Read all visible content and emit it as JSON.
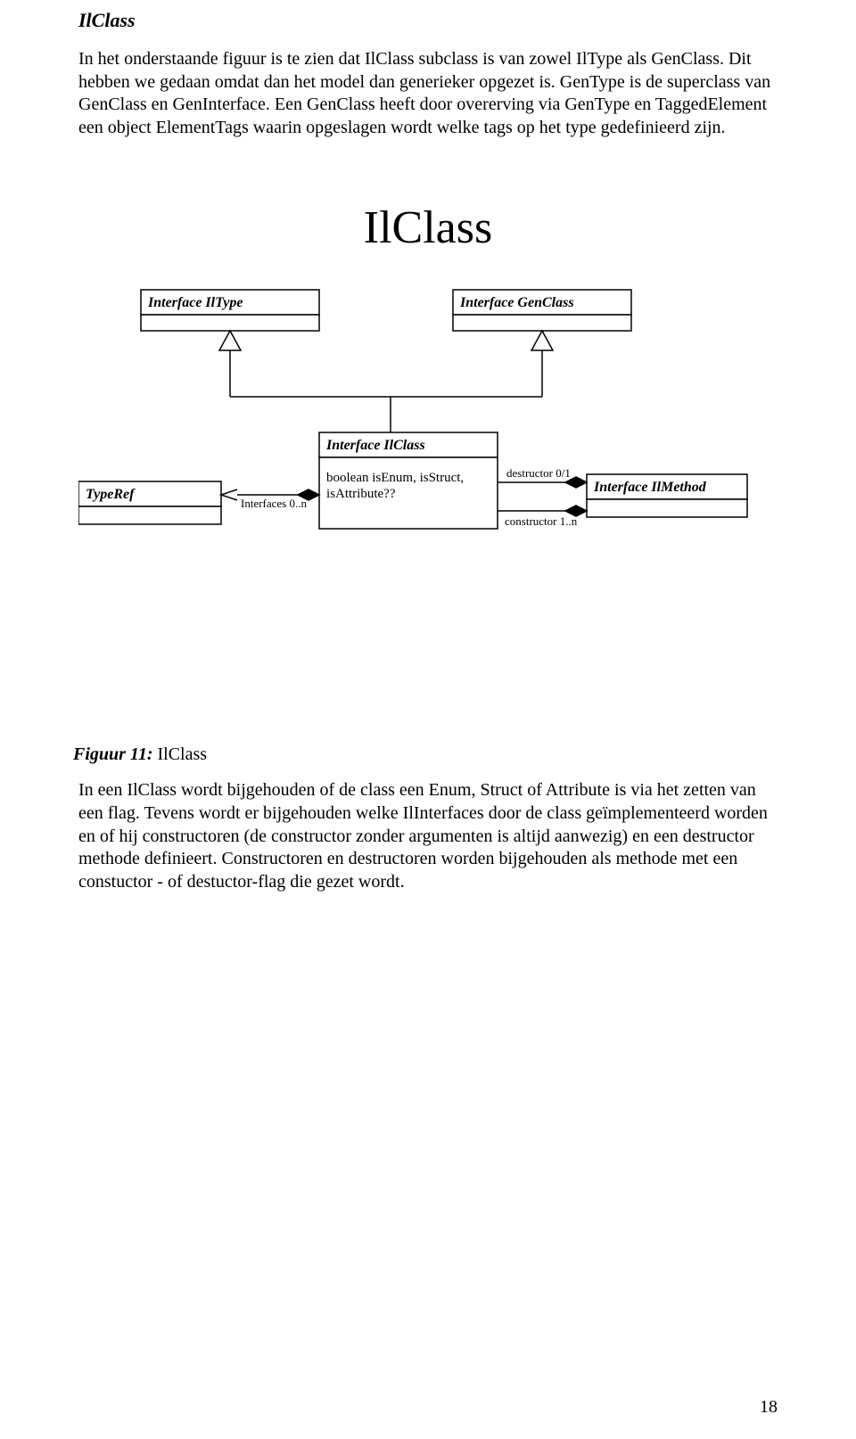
{
  "section_title": "IlClass",
  "paragraph1": "In het onderstaande figuur is te zien dat IlClass subclass is van zowel IlType als GenClass. Dit hebben we gedaan omdat dan het model dan generieker opgezet is. GenType is de superclass van GenClass en GenInterface. Een GenClass heeft door overerving via GenType en TaggedElement een object ElementTags waarin opgeslagen wordt welke tags op het type gedefinieerd zijn.",
  "diagram": {
    "title": "IlClass",
    "box_iltype": "Interface IlType",
    "box_genclass": "Interface GenClass",
    "box_ilclass_header": "Interface IlClass",
    "box_ilclass_body": "boolean isEnum, isStruct, isAttribute??",
    "box_typeref": "TypeRef",
    "box_ilmethod": "Interface IlMethod",
    "label_interfaces": "Interfaces 0..n",
    "label_destructor": "destructor 0/1",
    "label_constructor": "constructor 1..n"
  },
  "figure_caption_lead": "Figuur 11:",
  "figure_caption_rest": " IlClass",
  "paragraph2": "In een IlClass wordt bijgehouden of de class een Enum, Struct of Attribute is via het zetten van een flag. Tevens wordt er bijgehouden welke IlInterfaces door de class geïmplementeerd worden en of hij constructoren (de constructor zonder argumenten is altijd aanwezig) en een destructor methode definieert. Constructoren en destructoren worden bijgehouden als methode met een constuctor - of destuctor-flag die gezet wordt.",
  "page_number": "18"
}
